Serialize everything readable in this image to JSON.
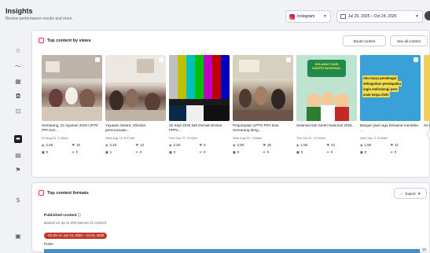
{
  "header": {
    "title": "Insights",
    "subtitle": "Review performance results and more.",
    "platform_label": "Instagram",
    "date_range": "Jul 25, 2025 – Oct 24, 2025"
  },
  "sidebar": {
    "icons": [
      "star-icon",
      "graph-icon",
      "grid-icon",
      "chat-icon",
      "cart-icon",
      "content-icon",
      "table-icon",
      "flag-icon",
      "dollar-icon",
      "document-icon"
    ]
  },
  "top_content": {
    "title": "Top content by views",
    "boost_label": "Boost content",
    "see_all_label": "See all content",
    "posts": [
      {
        "caption": "Semarang, 22 Agustus 2025 UPTD PPA Kot...",
        "date": "Fri Aug 22, 1:45am",
        "views": "2.2K",
        "likes": "15",
        "comments": "0",
        "shares": "0"
      },
      {
        "caption": "Yayasan Setara, Obrolan perencanaan...",
        "date": "Wed Aug 13, 8:47pm",
        "views": "2.2K",
        "likes": "24",
        "comments": "1",
        "shares": "0"
      },
      {
        "caption": "25 Sept 2025 kab Demak Dinsos PPPA...",
        "date": "Sun Sep 27, 8:02pm",
        "views": "2.2K",
        "likes": "5",
        "comments": "0",
        "shares": "0"
      },
      {
        "caption": "Perjumpaan UPTD PPA kota Semarang deng...",
        "date": "Wed Aug 20, 1:55am",
        "views": "2.0K",
        "likes": "25",
        "comments": "0",
        "shares": "0"
      },
      {
        "caption": "Selamat Hari Santri Nasional 2025...",
        "date": "Tue Oct 21, 11:53pm",
        "views": "1.5K",
        "likes": "44",
        "comments": "0",
        "shares": "0"
      },
      {
        "caption": "Bangun jiwa raga bersama merdeka ...",
        "date": "Wed Sep 3, 8:36am",
        "views": "1.5K",
        "likes": "11",
        "comments": "0",
        "shares": "0"
      },
      {
        "caption": "Se Ke...",
        "date": "",
        "views": "",
        "likes": "",
        "comments": "",
        "shares": ""
      }
    ],
    "thumb5_text": "SELAMAT HARI SANTRI NASIONAL",
    "thumb6_lines": [
      "Aku tanya pendengar",
      "dekngarkan pendapatku",
      "ingin melindungi pere",
      "anak tanpa diski"
    ]
  },
  "formats": {
    "title": "Top content formats",
    "export_label": "Export",
    "published_label": "Published content",
    "based_on": "Based on up to 200 pieces of content",
    "pill": "-83.3% vs. Apr 24, 2025 – Jul 24, 2025",
    "posts_label": "Posts",
    "posts_value": "16"
  },
  "colors": {
    "accent_red": "#f02849",
    "bar_blue": "#4a8bc2",
    "pill_red": "#c0392b"
  }
}
